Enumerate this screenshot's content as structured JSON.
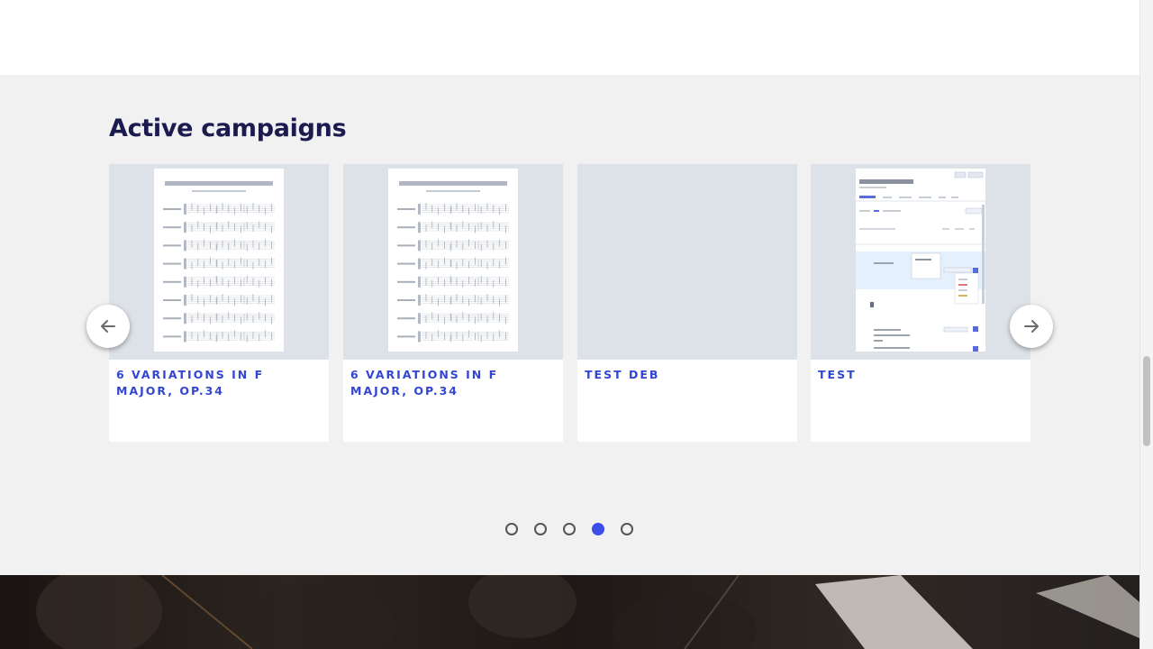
{
  "section": {
    "title": "Active campaigns"
  },
  "campaigns": [
    {
      "title": "6 VARIATIONS IN F MAJOR, OP.34",
      "thumbnail": "sheet-music-preview"
    },
    {
      "title": "6 VARIATIONS IN F MAJOR, OP.34",
      "thumbnail": "sheet-music-preview"
    },
    {
      "title": "TEST DEB",
      "thumbnail": "empty-preview"
    },
    {
      "title": "TEST",
      "thumbnail": "screenshot-preview"
    }
  ],
  "carousel": {
    "prev_icon": "arrow-left-icon",
    "next_icon": "arrow-right-icon",
    "page_count": 5,
    "active_page": 4
  },
  "colors": {
    "section_bg": "#f1f1f1",
    "title": "#1b1b50",
    "card_title": "#3346d3",
    "thumb_bg": "#dde2e8",
    "active_dot": "#3d4ee8"
  }
}
